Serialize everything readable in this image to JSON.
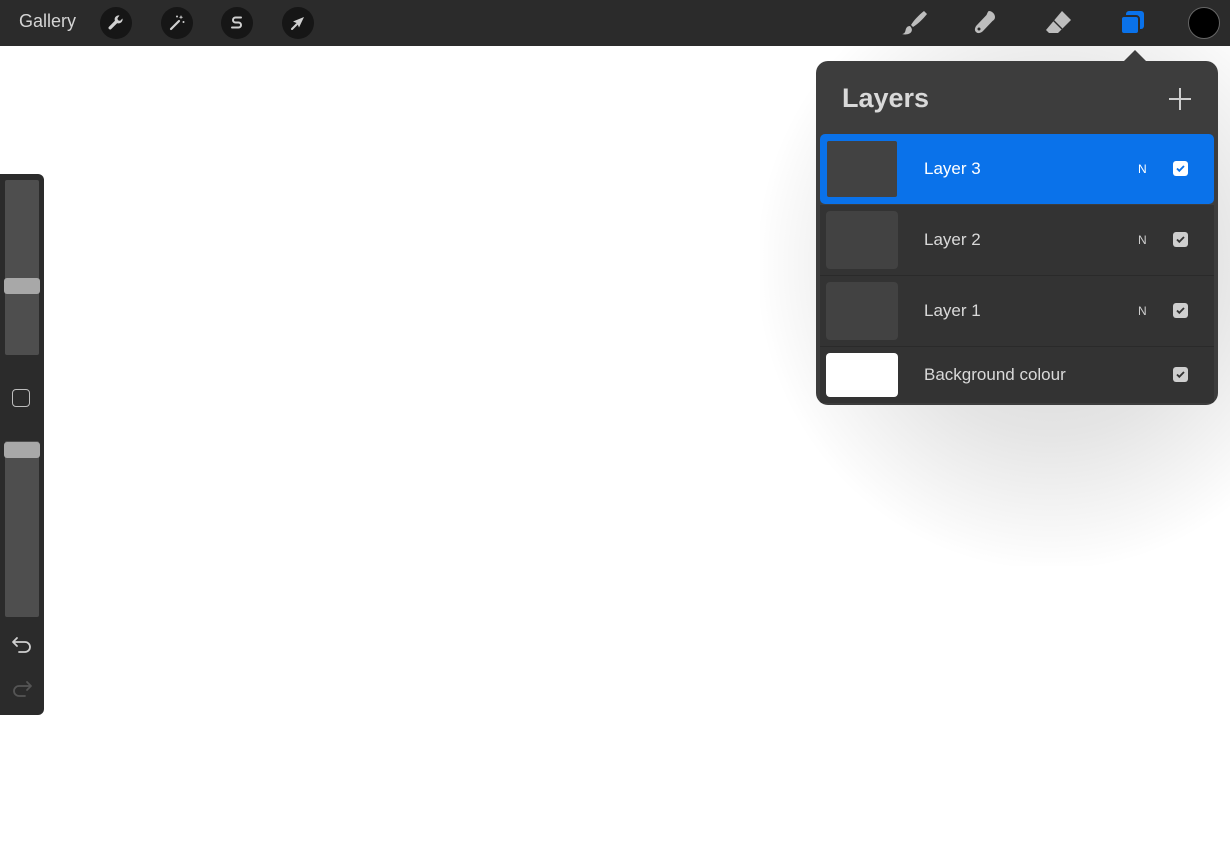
{
  "toolbar": {
    "gallery_label": "Gallery",
    "left_tools": [
      {
        "icon": "wrench-icon",
        "name": "actions"
      },
      {
        "icon": "magic-wand-icon",
        "name": "adjustments"
      },
      {
        "icon": "selection-s-icon",
        "name": "selection"
      },
      {
        "icon": "arrow-cursor-icon",
        "name": "transform"
      }
    ],
    "right_tools": [
      {
        "icon": "brush-icon",
        "name": "paint"
      },
      {
        "icon": "smudge-icon",
        "name": "smudge"
      },
      {
        "icon": "eraser-icon",
        "name": "erase"
      },
      {
        "icon": "layers-icon",
        "name": "layers",
        "active": true
      }
    ],
    "current_color": "#000000"
  },
  "layers_panel": {
    "title": "Layers",
    "add_icon": "plus-icon",
    "layers": [
      {
        "name": "Layer 3",
        "blend": "N",
        "visible": true,
        "active": true
      },
      {
        "name": "Layer 2",
        "blend": "N",
        "visible": true,
        "active": false
      },
      {
        "name": "Layer 1",
        "blend": "N",
        "visible": true,
        "active": false
      }
    ],
    "background": {
      "name": "Background colour",
      "visible": true,
      "color": "#ffffff"
    }
  },
  "sidebar": {
    "brush_size_level": 0.62,
    "opacity_level": 0.96,
    "modifier_icon": "square-modifier-icon",
    "undo_icon": "undo-icon",
    "redo_icon": "redo-icon"
  },
  "colors": {
    "accent": "#0a72ea",
    "toolbar_bg": "#2b2b2b",
    "panel_bg": "#3d3d3d"
  }
}
